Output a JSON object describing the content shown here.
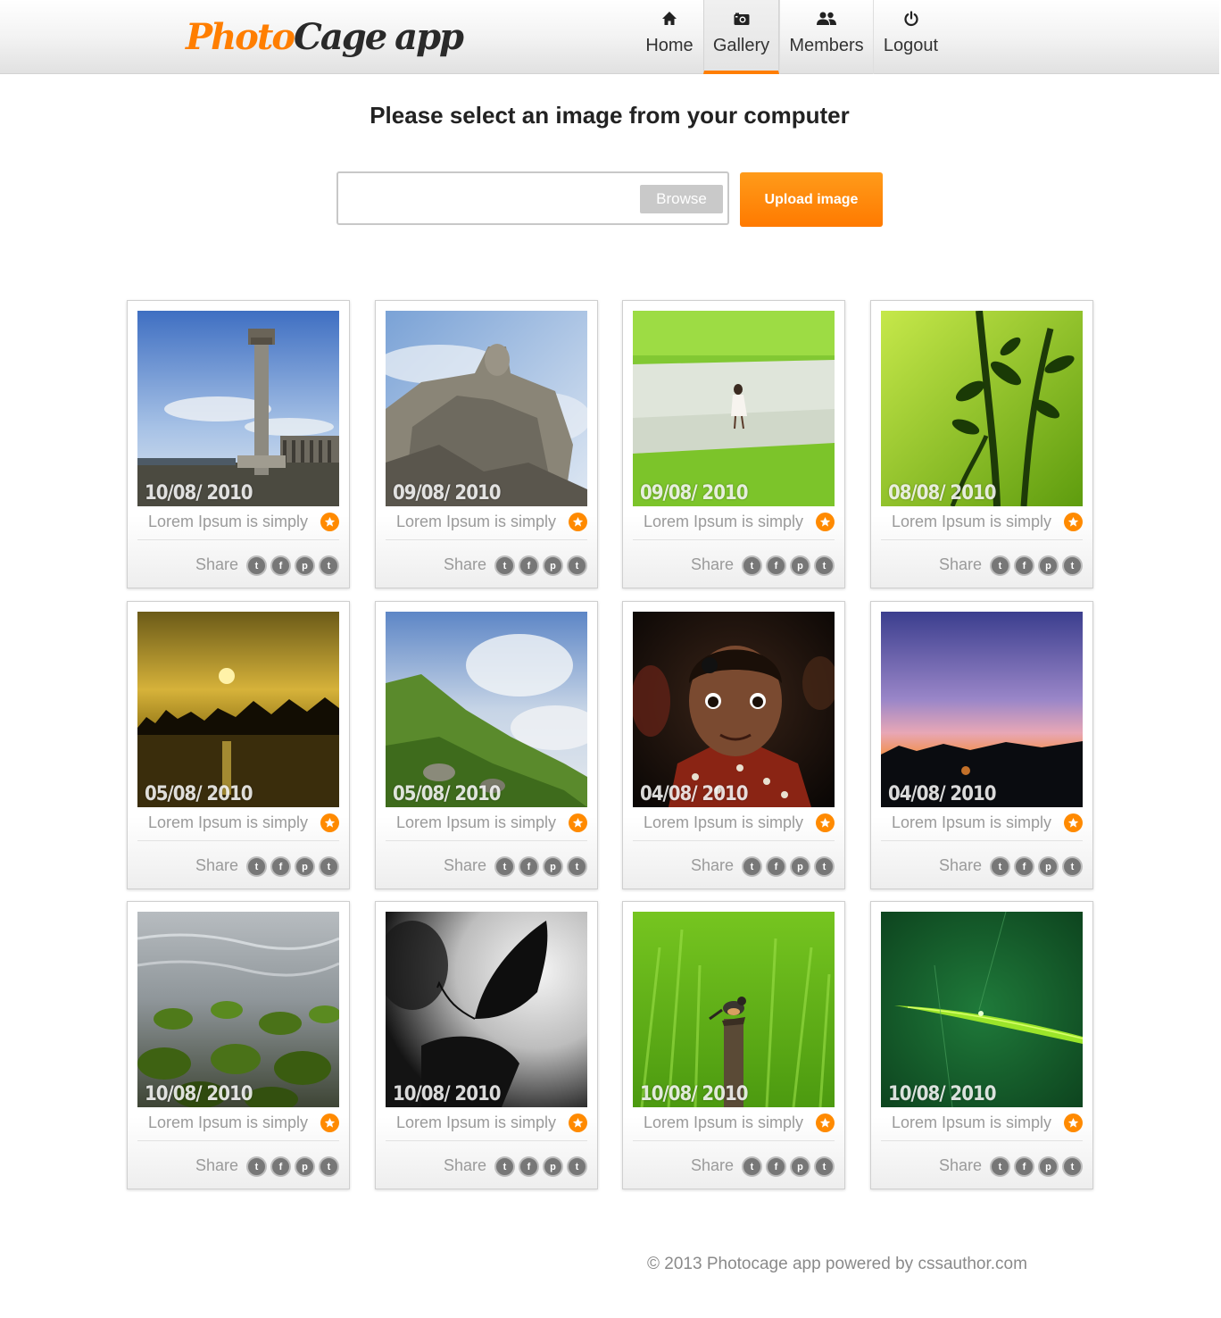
{
  "app": {
    "logo_part1": "Photo",
    "logo_part2": "Cage",
    "logo_part3": "app"
  },
  "colors": {
    "accent": "#ff7e00",
    "header_bg": "#eeeeee",
    "text_muted": "#9a9a9a"
  },
  "nav": {
    "items": [
      {
        "label": "Home",
        "icon": "home-icon",
        "active": false
      },
      {
        "label": "Gallery",
        "icon": "camera-icon",
        "active": true
      },
      {
        "label": "Members",
        "icon": "users-icon",
        "active": false
      },
      {
        "label": "Logout",
        "icon": "power-icon",
        "active": false
      }
    ]
  },
  "upload": {
    "heading": "Please select an image from your computer",
    "file_value": "",
    "browse_label": "Browse",
    "upload_label": "Upload image"
  },
  "gallery": {
    "share_label": "Share",
    "social_icons": [
      "twitter-icon",
      "facebook-icon",
      "pinterest-icon",
      "tumblr-icon"
    ],
    "cards": [
      {
        "date": "10/08/ 2010",
        "caption": "Lorem Ipsum is simply",
        "image": "stone-pillar-photo"
      },
      {
        "date": "09/08/ 2010",
        "caption": "Lorem Ipsum is simply",
        "image": "statue-photo"
      },
      {
        "date": "09/08/ 2010",
        "caption": "Lorem Ipsum is simply",
        "image": "girl-in-field-photo"
      },
      {
        "date": "08/08/ 2010",
        "caption": "Lorem Ipsum is simply",
        "image": "green-plant-photo"
      },
      {
        "date": "05/08/ 2010",
        "caption": "Lorem Ipsum is simply",
        "image": "sunset-lake-photo"
      },
      {
        "date": "05/08/ 2010",
        "caption": "Lorem Ipsum is simply",
        "image": "hill-clouds-photo"
      },
      {
        "date": "04/08/ 2010",
        "caption": "Lorem Ipsum is simply",
        "image": "child-portrait-photo"
      },
      {
        "date": "04/08/ 2010",
        "caption": "Lorem Ipsum is simply",
        "image": "dusk-sky-photo"
      },
      {
        "date": "10/08/ 2010",
        "caption": "Lorem Ipsum is simply",
        "image": "mossy-rocks-photo"
      },
      {
        "date": "10/08/ 2010",
        "caption": "Lorem Ipsum is simply",
        "image": "butterfly-silhouette-photo"
      },
      {
        "date": "10/08/ 2010",
        "caption": "Lorem Ipsum is simply",
        "image": "bird-on-post-photo"
      },
      {
        "date": "10/08/ 2010",
        "caption": "Lorem Ipsum is simply",
        "image": "dewdrop-leaf-photo"
      }
    ]
  },
  "footer": {
    "text": "© 2013 Photocage app powered by cssauthor.com"
  }
}
